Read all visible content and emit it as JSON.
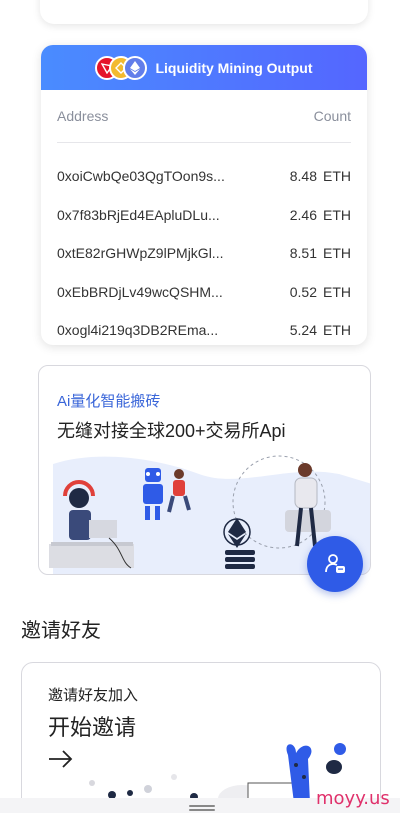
{
  "liquidity": {
    "title": "Liquidity Mining Output",
    "col_address": "Address",
    "col_count": "Count",
    "rows": [
      {
        "address": "0xoiCwbQe03QgTOon9s...",
        "amount": "8.48",
        "unit": "ETH"
      },
      {
        "address": "0x7f83bRjEd4EApluDLu...",
        "amount": "2.46",
        "unit": "ETH"
      },
      {
        "address": "0xtE82rGHWpZ9lPMjkGl...",
        "amount": "8.51",
        "unit": "ETH"
      },
      {
        "address": "0xEbBRDjLv49wcQSHM...",
        "amount": "0.52",
        "unit": "ETH"
      },
      {
        "address": "0xogl4i219q3DB2REma...",
        "amount": "5.24",
        "unit": "ETH"
      }
    ],
    "coin_icons": [
      "tron-icon",
      "bnb-icon",
      "ethereum-icon"
    ]
  },
  "ai_banner": {
    "title": "Ai量化智能搬砖",
    "subtitle": "无缝对接全球200+交易所Api"
  },
  "invite": {
    "section_title": "邀请好友",
    "card_small": "邀请好友加入",
    "card_big": "开始邀请"
  },
  "watermark": "moyy.us",
  "colors": {
    "header_gradient_start": "#4a8cff",
    "header_gradient_end": "#5466ff",
    "accent_blue": "#2f5be7",
    "ai_title": "#3a66d9",
    "watermark": "#e0316b"
  }
}
